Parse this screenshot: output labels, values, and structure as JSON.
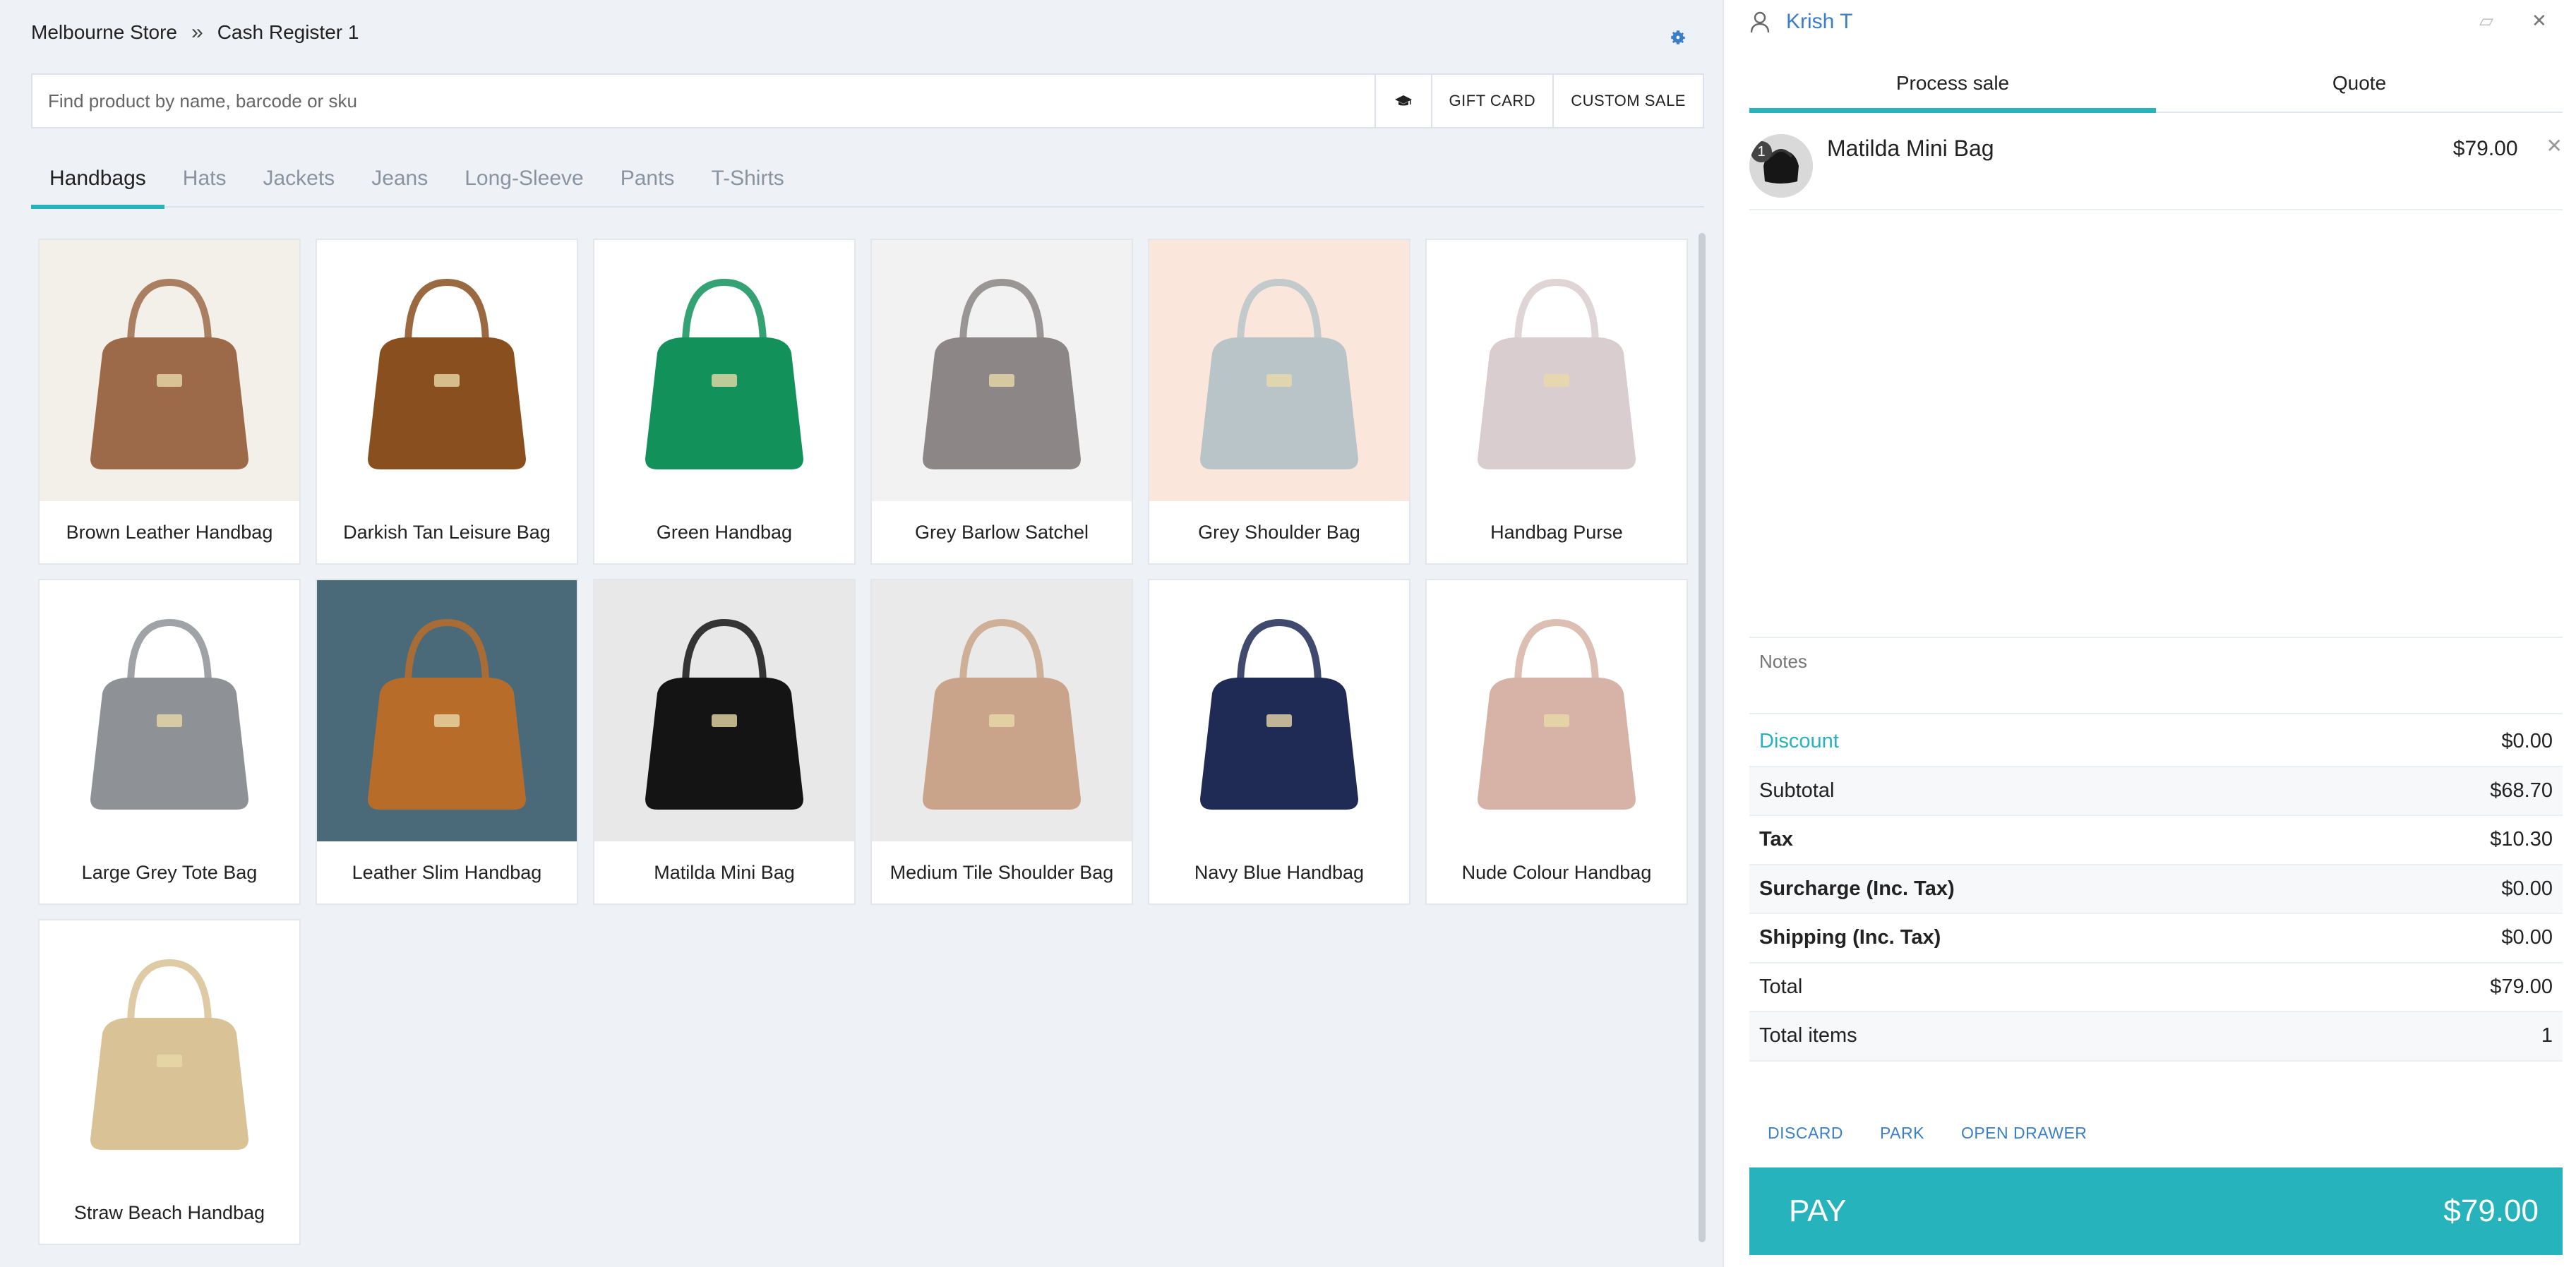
{
  "breadcrumb": {
    "store": "Melbourne Store",
    "separator": "»",
    "register": "Cash Register 1"
  },
  "search": {
    "placeholder": "Find product by name, barcode or sku",
    "gift_card": "GIFT CARD",
    "custom_sale": "CUSTOM SALE"
  },
  "categories": [
    "Handbags",
    "Hats",
    "Jackets",
    "Jeans",
    "Long-Sleeve",
    "Pants",
    "T-Shirts"
  ],
  "active_category": "Handbags",
  "products": [
    {
      "name": "Brown Leather Handbag",
      "bg": "#f3efe9",
      "bag": "#9c6a48"
    },
    {
      "name": "Darkish Tan Leisure Bag",
      "bg": "#ffffff",
      "bag": "#8a4f1f"
    },
    {
      "name": "Green Handbag",
      "bg": "#ffffff",
      "bag": "#12925a"
    },
    {
      "name": "Grey Barlow Satchel",
      "bg": "#f2f2f2",
      "bag": "#8c8686"
    },
    {
      "name": "Grey Shoulder Bag",
      "bg": "#fbe6dc",
      "bag": "#b9c4c8"
    },
    {
      "name": "Handbag Purse",
      "bg": "#ffffff",
      "bag": "#d9cdcf"
    },
    {
      "name": "Large Grey Tote Bag",
      "bg": "#ffffff",
      "bag": "#8e9297"
    },
    {
      "name": "Leather Slim Handbag",
      "bg": "#4a6a7a",
      "bag": "#b86c2a"
    },
    {
      "name": "Matilda Mini Bag",
      "bg": "#e8e8e8",
      "bag": "#141414"
    },
    {
      "name": "Medium Tile Shoulder Bag",
      "bg": "#eaeaea",
      "bag": "#c9a48a"
    },
    {
      "name": "Navy Blue Handbag",
      "bg": "#ffffff",
      "bag": "#1f2a55"
    },
    {
      "name": "Nude Colour Handbag",
      "bg": "#ffffff",
      "bag": "#d6b3a6"
    },
    {
      "name": "Straw Beach Handbag",
      "bg": "#ffffff",
      "bag": "#d8c296"
    }
  ],
  "sale": {
    "customer": "Krish T",
    "tabs": [
      "Process sale",
      "Quote"
    ],
    "items": [
      {
        "qty": "1",
        "name": "Matilda Mini Bag",
        "price": "$79.00"
      }
    ],
    "notes_placeholder": "Notes",
    "totals": [
      {
        "label": "Discount",
        "value": "$0.00"
      },
      {
        "label": "Subtotal",
        "value": "$68.70"
      },
      {
        "label": "Tax",
        "value": "$10.30"
      },
      {
        "label": "Surcharge (Inc. Tax)",
        "value": "$0.00"
      },
      {
        "label": "Shipping (Inc. Tax)",
        "value": "$0.00"
      },
      {
        "label": "Total",
        "value": "$79.00"
      },
      {
        "label": "Total items",
        "value": "1"
      }
    ],
    "actions": [
      "DISCARD",
      "PARK",
      "OPEN DRAWER"
    ],
    "pay_label": "PAY",
    "pay_amount": "$79.00"
  },
  "colors": {
    "accent": "#26b3bc",
    "link": "#3b7ec8"
  }
}
